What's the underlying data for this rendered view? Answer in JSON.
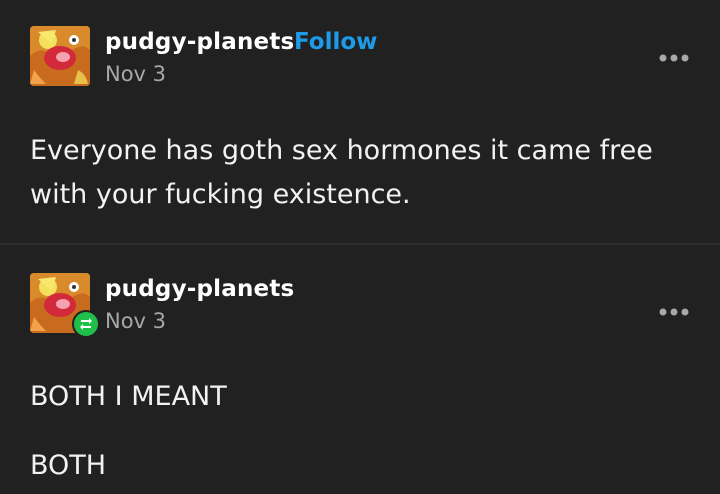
{
  "posts": [
    {
      "blog": "pudgy-planets",
      "follow_label": "Follow",
      "date": "Nov 3",
      "more_icon": "ellipsis-icon",
      "text_lines": [
        "Everyone has goth sex hormones it came free",
        "with your fucking existence."
      ]
    },
    {
      "blog": "pudgy-planets",
      "date": "Nov 3",
      "badge_icon": "reblog-icon",
      "more_icon": "ellipsis-icon",
      "paragraphs": [
        "BOTH I MEANT",
        "BOTH"
      ]
    }
  ],
  "colors": {
    "background": "#212121",
    "accent": "#1e9be8",
    "reblog": "#1fbf4a",
    "muted": "#a8a8a8"
  }
}
